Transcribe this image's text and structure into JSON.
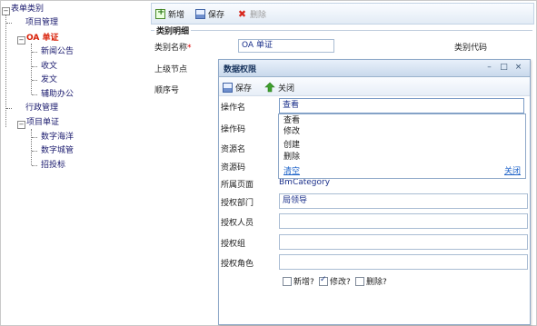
{
  "tree": {
    "root": "表单类别",
    "items": [
      {
        "label": "项目管理",
        "level": 1
      },
      {
        "label": "OA 单证",
        "level": 1,
        "active": true
      },
      {
        "label": "新闻公告",
        "level": 2
      },
      {
        "label": "收文",
        "level": 2
      },
      {
        "label": "发文",
        "level": 2
      },
      {
        "label": "辅助办公",
        "level": 2
      },
      {
        "label": "行政管理",
        "level": 1
      },
      {
        "label": "项目单证",
        "level": 1
      },
      {
        "label": "数字海洋",
        "level": 2
      },
      {
        "label": "数字城管",
        "level": 2
      },
      {
        "label": "招投标",
        "level": 2
      }
    ]
  },
  "main": {
    "toolbar": {
      "add": "新增",
      "save": "保存",
      "delete": "删除"
    },
    "section_title": "类别明细",
    "fields": {
      "category_name_label": "类别名称",
      "category_name_value": "OA 单证",
      "category_code_label": "类别代码",
      "parent_node_label": "上级节点",
      "order_label": "顺序号"
    }
  },
  "modal": {
    "title": "数据权限",
    "toolbar": {
      "save": "保存",
      "close": "关闭"
    },
    "rows": [
      {
        "label": "操作名",
        "value": "查看"
      },
      {
        "label": "操作码",
        "value": ""
      },
      {
        "label": "资源名",
        "value": ""
      },
      {
        "label": "资源码",
        "value": ""
      },
      {
        "label": "所属页面",
        "value": "BmCategory"
      },
      {
        "label": "授权部门",
        "value": "局领导"
      },
      {
        "label": "授权人员",
        "value": ""
      },
      {
        "label": "授权组",
        "value": ""
      },
      {
        "label": "授权角色",
        "value": ""
      }
    ],
    "dropdown": {
      "options": [
        "查看",
        "修改",
        "创建",
        "删除"
      ],
      "clear": "清空",
      "close": "关闭"
    },
    "checkboxes": [
      {
        "label": "新增?",
        "checked": false
      },
      {
        "label": "修改?",
        "checked": true
      },
      {
        "label": "删除?",
        "checked": false
      }
    ]
  }
}
